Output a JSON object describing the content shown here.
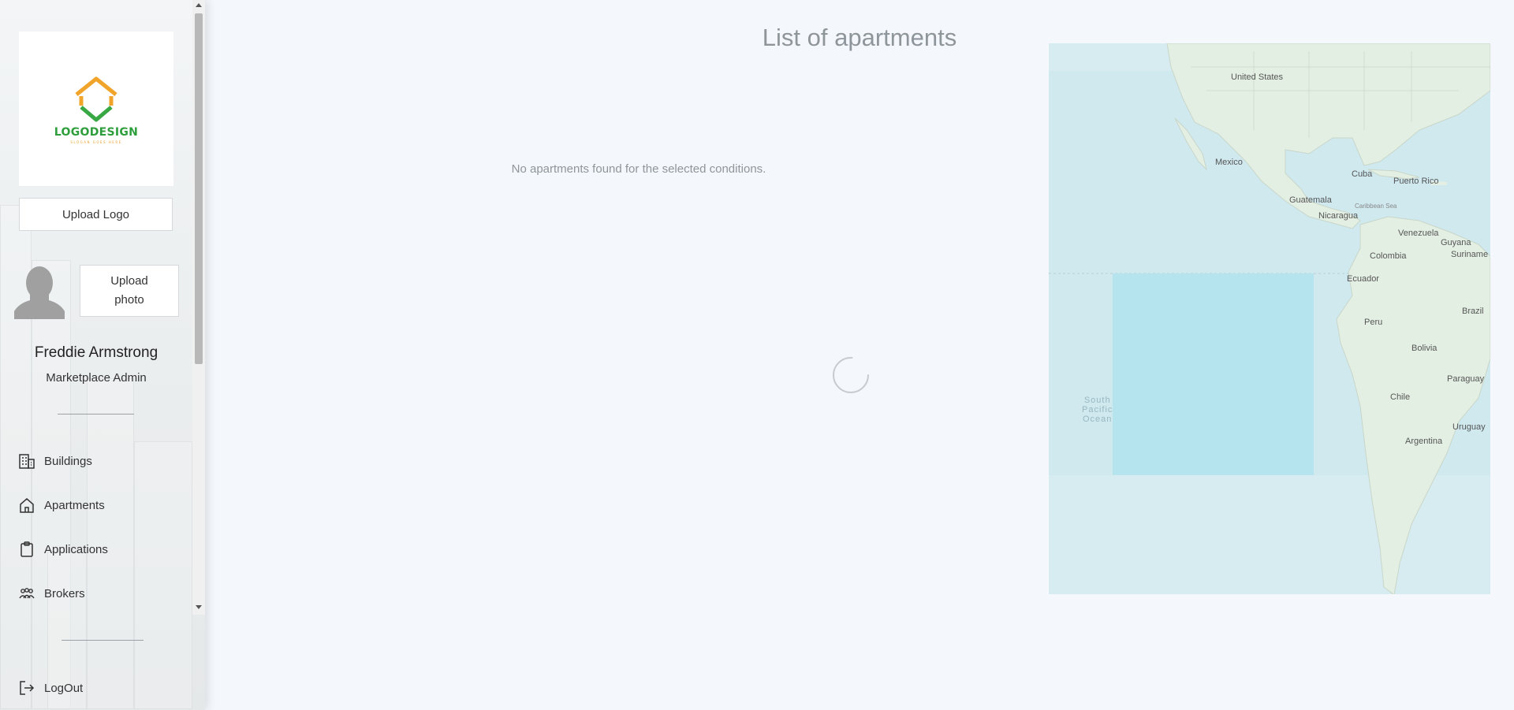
{
  "sidebar": {
    "logo": {
      "text": "LOGODESIGN",
      "slogan": "SLOGAN GOES HERE",
      "orange": "#f0a52a",
      "green": "#38a845"
    },
    "upload_logo_label": "Upload Logo",
    "upload_photo_label": "Upload photo",
    "user_name": "Freddie Armstrong",
    "user_role": "Marketplace Admin",
    "nav": [
      {
        "label": "Buildings",
        "icon": "buildings-icon"
      },
      {
        "label": "Apartments",
        "icon": "home-icon"
      },
      {
        "label": "Applications",
        "icon": "clipboard-icon"
      },
      {
        "label": "Brokers",
        "icon": "people-icon"
      }
    ],
    "logout_label": "LogOut"
  },
  "main": {
    "title": "List of apartments",
    "empty_message": "No apartments found for the selected conditions."
  },
  "map": {
    "labels": {
      "united_states": "United States",
      "mexico": "Mexico",
      "cuba": "Cuba",
      "puerto_rico": "Puerto Rico",
      "guatemala": "Guatemala",
      "caribbean_sea": "Caribbean Sea",
      "nicaragua": "Nicaragua",
      "venezuela": "Venezuela",
      "guyana": "Guyana",
      "suriname": "Suriname",
      "colombia": "Colombia",
      "ecuador": "Ecuador",
      "peru": "Peru",
      "brazil": "Brazil",
      "bolivia": "Bolivia",
      "paraguay": "Paraguay",
      "chile": "Chile",
      "uruguay": "Uruguay",
      "argentina": "Argentina",
      "south_pacific_ocean_1": "South",
      "south_pacific_ocean_2": "Pacific",
      "south_pacific_ocean_3": "Ocean"
    },
    "colors": {
      "water": "#cfe9ef",
      "land": "#e4efe4",
      "highlight": "#b6e4ee"
    }
  }
}
